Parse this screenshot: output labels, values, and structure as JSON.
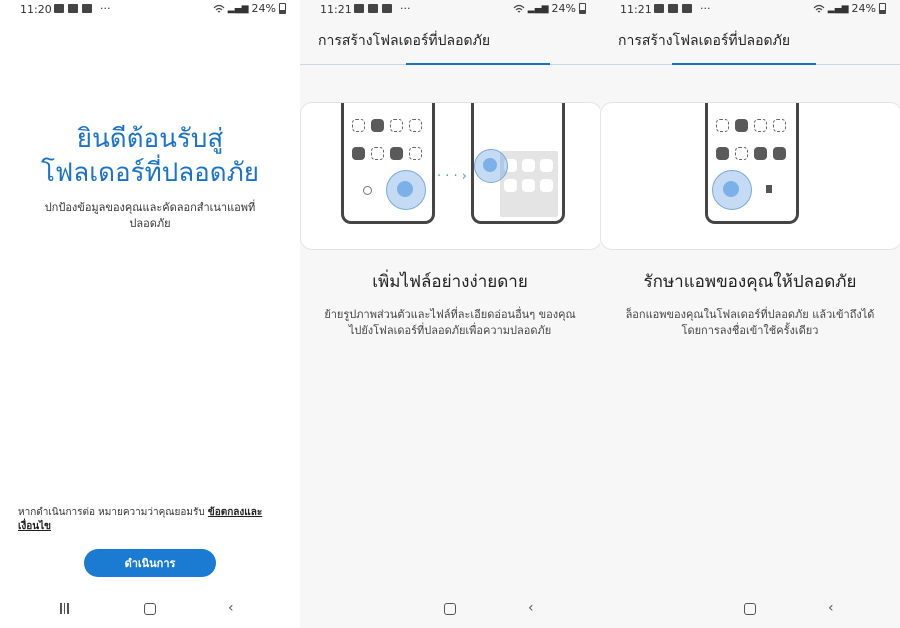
{
  "panel1": {
    "status": {
      "time": "11:20",
      "battery": "24%",
      "dots": "···"
    },
    "welcome_title": "ยินดีต้อนรับสู่โฟลเดอร์ที่ปลอดภัย",
    "welcome_subtitle": "ปกป้องข้อมูลของคุณและคัดลอกสำเนาแอพที่ปลอดภัย",
    "terms_prefix": "หากดำเนินการต่อ หมายความว่าคุณยอมรับ ",
    "terms_link": "ข้อตกลงและเงื่อนไข",
    "continue_label": "ดำเนินการ"
  },
  "panel2": {
    "status": {
      "time": "11:21",
      "battery": "24%",
      "dots": "···"
    },
    "header_title": "การสร้างโฟลเดอร์ที่ปลอดภัย",
    "heading": "เพิ่มไฟล์อย่างง่ายดาย",
    "description": "ย้ายรูปภาพส่วนตัวและไฟล์ที่ละเอียดอ่อนอื่นๆ ของคุณไปยังโฟลเดอร์ที่ปลอดภัยเพื่อความปลอดภัย"
  },
  "panel3": {
    "status": {
      "time": "11:21",
      "battery": "24%",
      "dots": "···"
    },
    "header_title": "การสร้างโฟลเดอร์ที่ปลอดภัย",
    "heading": "รักษาแอพของคุณให้ปลอดภัย",
    "description": "ล็อกแอพของคุณในโฟลเดอร์ที่ปลอดภัย แล้วเข้าถึงได้โดยการลงชื่อเข้าใช้ครั้งเดียว"
  },
  "status_icons": [
    "gallery-icon",
    "youtube-icon",
    "message-icon",
    "wifi-icon",
    "volte-icon",
    "signal-icon",
    "battery-icon"
  ],
  "colors": {
    "accent": "#1b7ad1",
    "title_blue": "#1a73c9",
    "indicator": "#1b6fc4"
  }
}
